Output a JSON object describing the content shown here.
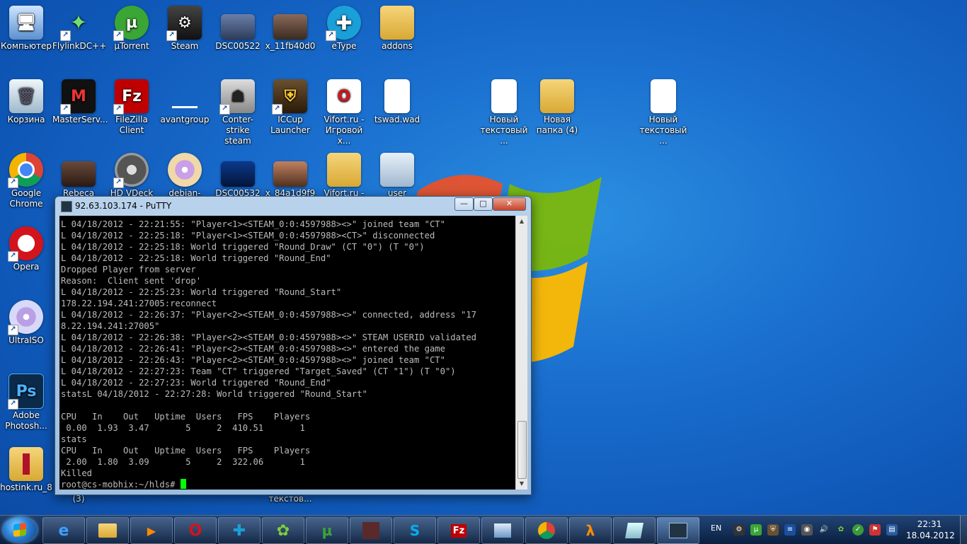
{
  "desktop_icons": {
    "komputer": "Компьютер",
    "flylink": "FlylinkDC++",
    "utorrent": "µTorrent",
    "steam": "Steam",
    "dsc00522": "DSC00522",
    "x11fb": "x_11fb40d0",
    "etype": "eType",
    "addons": "addons",
    "korzina": "Корзина",
    "masterserver": "MasterServ...",
    "filezilla": "FileZilla Client",
    "avantgroup": "avantgroup",
    "cstrike": "Conter-strike steam",
    "iccup": "ICCup Launcher",
    "vifort1": "Vifort.ru - Игровой х...",
    "tswad": "tswad.wad",
    "newtext1": "Новый текстовый ...",
    "newfolder": "Новая папка (4)",
    "newtext2": "Новый текстовый ...",
    "chrome": "Google Chrome",
    "rebeca": "Rebeca",
    "hdvdeck": "HD VDeck",
    "debian": "debian-6.0...",
    "dsc00532": "DSC00532",
    "x84": "x_84a1d9f9",
    "vifort2": "Vifort.ru -",
    "user": "user",
    "opera": "Opera",
    "ultraiso": "UltraISO",
    "photoshop": "Adobe Photosh...",
    "hostink": "hostink.ru_8",
    "hidden1": "(3)",
    "hidden2": "текстов..."
  },
  "putty": {
    "title": "92.63.103.174 - PuTTY",
    "btn_min": "—",
    "btn_max": "□",
    "btn_close": "✕",
    "terminal_lines": [
      "L 04/18/2012 - 22:21:55: \"Player<1><STEAM_0:0:4597988><>\" joined team \"CT\"",
      "L 04/18/2012 - 22:25:18: \"Player<1><STEAM_0:0:4597988><CT>\" disconnected",
      "L 04/18/2012 - 22:25:18: World triggered \"Round_Draw\" (CT \"0\") (T \"0\")",
      "L 04/18/2012 - 22:25:18: World triggered \"Round_End\"",
      "Dropped Player from server",
      "Reason:  Client sent 'drop'",
      "L 04/18/2012 - 22:25:23: World triggered \"Round_Start\"",
      "178.22.194.241:27005:reconnect",
      "L 04/18/2012 - 22:26:37: \"Player<2><STEAM_0:0:4597988><>\" connected, address \"17",
      "8.22.194.241:27005\"",
      "L 04/18/2012 - 22:26:38: \"Player<2><STEAM_0:0:4597988><>\" STEAM USERID validated",
      "L 04/18/2012 - 22:26:41: \"Player<2><STEAM_0:0:4597988><>\" entered the game",
      "L 04/18/2012 - 22:26:43: \"Player<2><STEAM_0:0:4597988><>\" joined team \"CT\"",
      "L 04/18/2012 - 22:27:23: Team \"CT\" triggered \"Target_Saved\" (CT \"1\") (T \"0\")",
      "L 04/18/2012 - 22:27:23: World triggered \"Round_End\"",
      "statsL 04/18/2012 - 22:27:28: World triggered \"Round_Start\"",
      "",
      "CPU   In    Out   Uptime  Users   FPS    Players",
      " 0.00  1.93  3.47       5     2  410.51       1",
      "stats",
      "CPU   In    Out   Uptime  Users   FPS    Players",
      " 2.00  1.80  3.09       5     2  322.06       1",
      "Killed"
    ],
    "prompt": "root@cs-mobhix:~/hlds# "
  },
  "taskbar": {
    "lang": "EN",
    "time": "22:31",
    "date": "18.04.2012"
  }
}
